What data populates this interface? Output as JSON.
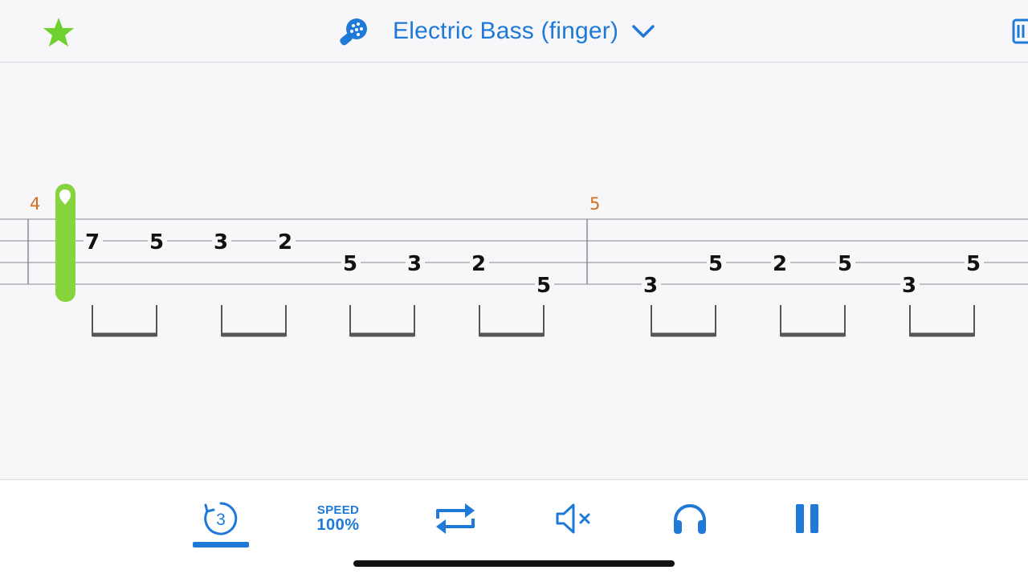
{
  "header": {
    "favorite_icon": "star-icon",
    "instrument_icon": "guitar-pick-icon",
    "instrument_name": "Electric Bass (finger)",
    "dropdown_icon": "chevron-down-icon",
    "score_icon": "score-view-icon"
  },
  "tab": {
    "measures": [
      {
        "number": "4",
        "notes": [
          {
            "fret": "7",
            "string": 1
          },
          {
            "fret": "5",
            "string": 1
          },
          {
            "fret": "3",
            "string": 1
          },
          {
            "fret": "2",
            "string": 1
          },
          {
            "fret": "5",
            "string": 2
          },
          {
            "fret": "3",
            "string": 2
          },
          {
            "fret": "2",
            "string": 2
          },
          {
            "fret": "5",
            "string": 3
          }
        ]
      },
      {
        "number": "5",
        "notes": [
          {
            "fret": "3",
            "string": 3
          },
          {
            "fret": "5",
            "string": 2
          },
          {
            "fret": "2",
            "string": 2
          },
          {
            "fret": "5",
            "string": 2
          },
          {
            "fret": "3",
            "string": 3
          },
          {
            "fret": "5",
            "string": 2
          }
        ]
      }
    ],
    "playhead_color": "#86d43c",
    "measure_number_color": "#d06e22"
  },
  "toolbar": {
    "countin_value": "3",
    "speed_label": "SPEED",
    "speed_value": "100%",
    "loop_icon": "loop-icon",
    "mute_icon": "speaker-muted-icon",
    "headphones_icon": "headphones-icon",
    "pause_icon": "pause-icon"
  },
  "colors": {
    "accent": "#1e7ad6",
    "favorite": "#6ed12f"
  }
}
